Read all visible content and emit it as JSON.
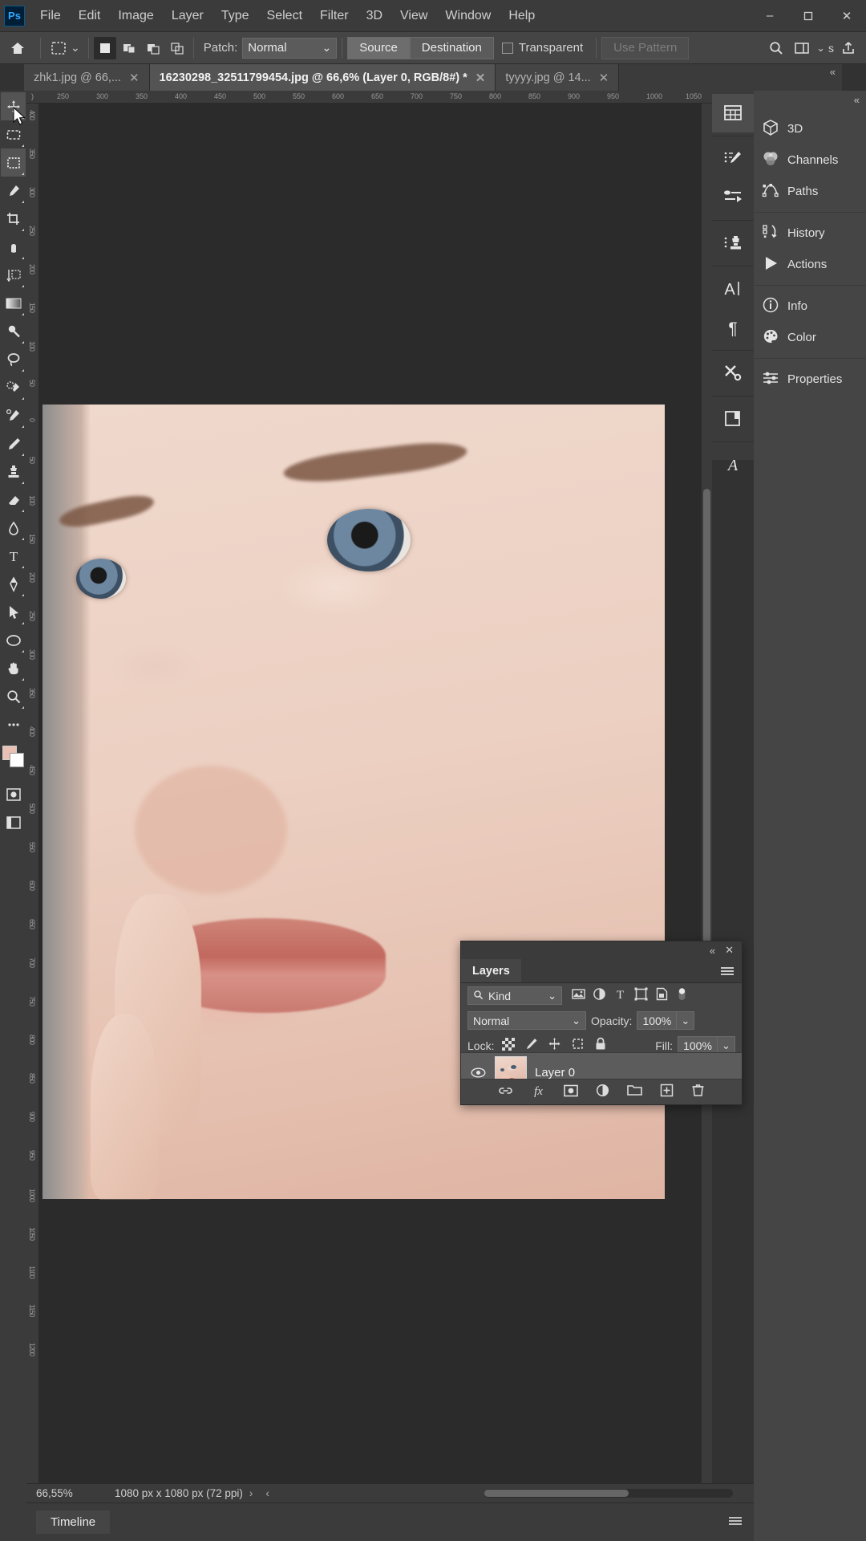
{
  "app": {
    "name": "Adobe Photoshop",
    "logo_text": "Ps"
  },
  "menubar": {
    "items": [
      "File",
      "Edit",
      "Image",
      "Layer",
      "Type",
      "Select",
      "Filter",
      "3D",
      "View",
      "Window",
      "Help"
    ],
    "window_controls": {
      "minimize": "–",
      "maximize": "❐",
      "close": "✕"
    }
  },
  "optionsbar": {
    "home_icon": "home-icon",
    "tool_preset_icon": "patch-tool-icon",
    "tool_preset_caret": "⌄",
    "selection_modes": [
      "new-selection-icon",
      "add-to-selection-icon",
      "subtract-from-selection-icon",
      "intersect-selection-icon"
    ],
    "patch_label": "Patch:",
    "patch_value": "Normal",
    "patch_caret": "⌄",
    "source_label": "Source",
    "destination_label": "Destination",
    "transparent_label": "Transparent",
    "transparent_checked": false,
    "use_pattern_label": "Use Pattern",
    "use_pattern_disabled": true,
    "search_icon": "search-icon",
    "workspace_icon": "workspace-icon",
    "workspace_caret": "⌄",
    "workspace_short": "s",
    "share_icon": "share-icon"
  },
  "tabs": [
    {
      "label": "zhk1.jpg @ 66,...",
      "active": false,
      "close": "✕"
    },
    {
      "label": "16230298_32511799454.jpg @ 66,6% (Layer 0, RGB/8#) *",
      "active": true,
      "close": "✕"
    },
    {
      "label": "tyyyy.jpg @ 14...",
      "active": false,
      "close": "✕"
    }
  ],
  "tab_collapse_icon": "«",
  "toolbar": {
    "tools": [
      {
        "name": "move-tool",
        "glyph": "✥",
        "active": true
      },
      {
        "name": "rectangular-marquee-tool",
        "glyph": "⬚",
        "active": false
      },
      {
        "name": "object-selection-tool",
        "glyph": "⬚",
        "active": true
      },
      {
        "name": "eyedropper-tool",
        "glyph": "✐",
        "active": false
      },
      {
        "name": "crop-tool",
        "glyph": "⌧",
        "active": false
      },
      {
        "name": "frame-tool",
        "glyph": "✋",
        "active": false
      },
      {
        "name": "type-mask-tool",
        "glyph": "↧",
        "active": false
      },
      {
        "name": "gradient-tool",
        "glyph": "■",
        "active": false
      },
      {
        "name": "spot-healing-brush-tool",
        "glyph": "⚲",
        "active": false
      },
      {
        "name": "lasso-tool",
        "glyph": "⬭",
        "active": false
      },
      {
        "name": "patch-tool",
        "glyph": "❁",
        "active": false
      },
      {
        "name": "color-replacement-tool",
        "glyph": "✐",
        "active": false
      },
      {
        "name": "brush-tool",
        "glyph": "✒",
        "active": false
      },
      {
        "name": "clone-stamp-tool",
        "glyph": "⚑",
        "active": false
      },
      {
        "name": "eraser-tool",
        "glyph": "◢",
        "active": false
      },
      {
        "name": "blur-tool",
        "glyph": "◌",
        "active": false
      },
      {
        "name": "horizontal-type-tool",
        "glyph": "T",
        "active": false
      },
      {
        "name": "pen-tool",
        "glyph": "✒",
        "active": false
      },
      {
        "name": "path-selection-tool",
        "glyph": "➤",
        "active": false
      },
      {
        "name": "ellipse-tool",
        "glyph": "◯",
        "active": false
      },
      {
        "name": "hand-tool",
        "glyph": "✋",
        "active": false
      },
      {
        "name": "zoom-tool",
        "glyph": "⚲",
        "active": false
      },
      {
        "name": "edit-toolbar-button",
        "glyph": "⋯",
        "active": false
      }
    ],
    "foreground_color": "#e8c0b4",
    "background_color": "#ffffff",
    "quick_mask_icon": "quick-mask-icon",
    "screen_mode_icon": "screen-mode-icon"
  },
  "rulers": {
    "horizontal_ticks": [
      "250",
      "300",
      "350",
      "400",
      "450",
      "500",
      "550",
      "600",
      "650",
      "700",
      "750",
      "800",
      "850",
      "900",
      "950",
      "1000",
      "1050"
    ],
    "vertical_ticks": [
      "400",
      "350",
      "300",
      "250",
      "200",
      "150",
      "100",
      "50",
      "0",
      "50",
      "100",
      "150",
      "200",
      "250",
      "300",
      "350",
      "400",
      "450",
      "500",
      "550",
      "600",
      "650",
      "700",
      "750",
      "800",
      "850",
      "900",
      "950",
      "1000",
      "1050",
      "1100",
      "1150",
      "1200"
    ]
  },
  "icon_dock": {
    "groups": [
      [
        {
          "name": "libraries-icon",
          "glyph": "grid"
        }
      ],
      [
        {
          "name": "brush-settings-icon",
          "glyph": "brush"
        },
        {
          "name": "brush-presets-icon",
          "glyph": "sliders"
        }
      ],
      [
        {
          "name": "clone-source-icon",
          "glyph": "stamp"
        }
      ],
      [
        {
          "name": "character-icon",
          "glyph": "A"
        },
        {
          "name": "paragraph-icon",
          "glyph": "¶"
        }
      ],
      [
        {
          "name": "adjustments-icon",
          "glyph": "tools"
        }
      ],
      [
        {
          "name": "layer-comps-icon",
          "glyph": "book"
        }
      ],
      [
        {
          "name": "glyphs-icon",
          "glyph": "A-script"
        }
      ]
    ]
  },
  "right_panel": {
    "collapse_icon": "«",
    "groups": [
      [
        {
          "label": "3D",
          "icon": "cube-icon"
        },
        {
          "label": "Channels",
          "icon": "channels-icon"
        },
        {
          "label": "Paths",
          "icon": "paths-icon"
        }
      ],
      [
        {
          "label": "History",
          "icon": "history-icon"
        },
        {
          "label": "Actions",
          "icon": "actions-play-icon"
        }
      ],
      [
        {
          "label": "Info",
          "icon": "info-icon"
        },
        {
          "label": "Color",
          "icon": "color-palette-icon"
        }
      ],
      [
        {
          "label": "Properties",
          "icon": "properties-sliders-icon"
        }
      ]
    ]
  },
  "layers_panel": {
    "title": "Layers",
    "collapse_icon": "«",
    "close_icon": "✕",
    "menu_icon": "panel-menu-icon",
    "filter": {
      "search_icon": "search-icon",
      "value": "Kind",
      "caret": "⌄"
    },
    "filter_icons": [
      "pixel-layers-filter-icon",
      "adjustment-layers-filter-icon",
      "type-layers-filter-icon",
      "shape-layers-filter-icon",
      "smart-object-filter-icon",
      "filter-toggle-switch"
    ],
    "blend_mode": "Normal",
    "blend_caret": "⌄",
    "opacity_label": "Opacity:",
    "opacity_value": "100%",
    "opacity_caret": "⌄",
    "lock_label": "Lock:",
    "lock_icons": [
      "lock-transparent-pixels-icon",
      "lock-image-pixels-icon",
      "lock-position-icon",
      "lock-artboard-nesting-icon",
      "lock-all-icon"
    ],
    "fill_label": "Fill:",
    "fill_value": "100%",
    "fill_caret": "⌄",
    "layers": [
      {
        "name": "Layer 0",
        "visible": true,
        "selected": true,
        "thumb": "face-thumbnail"
      }
    ],
    "footer_icons": [
      "link-layers-icon",
      "add-layer-style-icon",
      "add-layer-mask-icon",
      "new-adjustment-layer-icon",
      "new-group-icon",
      "new-layer-icon",
      "delete-layer-icon"
    ]
  },
  "statusbar": {
    "zoom": "66,55%",
    "doc_dimensions": "1080 px x 1080 px (72 ppi)",
    "next_arrow": "›",
    "prev_arrow": "‹"
  },
  "timeline": {
    "tab_label": "Timeline",
    "menu_icon": "panel-menu-icon"
  }
}
